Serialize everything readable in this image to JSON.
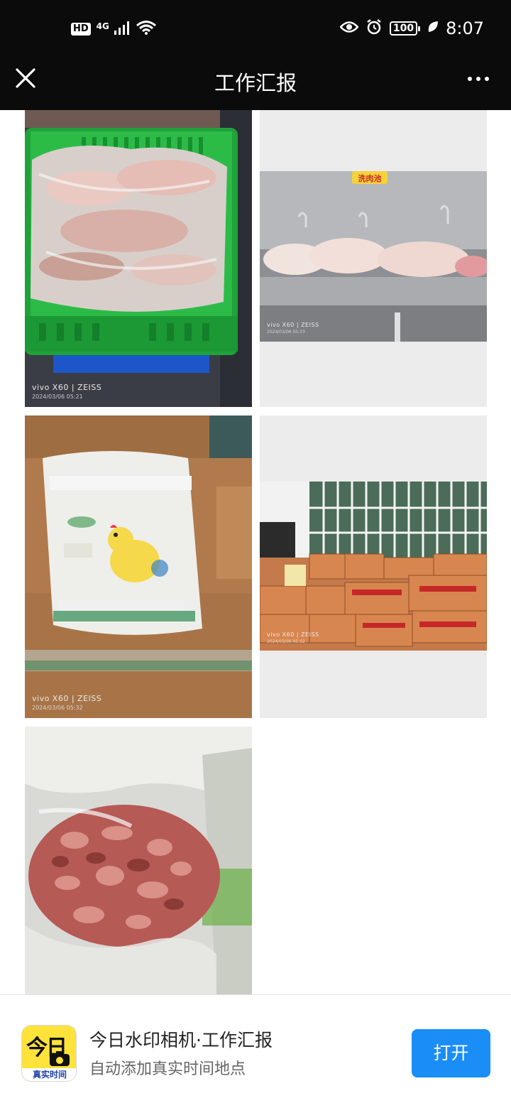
{
  "status_bar": {
    "hd": "HD",
    "network": "4G",
    "battery": "100",
    "time": "8:07"
  },
  "header": {
    "title": "工作汇报"
  },
  "photos": [
    {
      "brand": "vivo X60 | ZEISS",
      "date": "2024/03/06 05:21"
    },
    {
      "brand": "vivo X60 | ZEISS",
      "date": "2024/03/06 05:33",
      "sign": "洗肉池"
    },
    {
      "brand": "vivo X60 | ZEISS",
      "date": "2024/03/06 05:32"
    },
    {
      "brand": "vivo X60 | ZEISS",
      "date": "2024/03/06 05:32"
    },
    {
      "brand": "",
      "date": ""
    }
  ],
  "banner": {
    "icon_text": "今日",
    "icon_strip": "真实时间",
    "title": "今日水印相机·工作汇报",
    "subtitle": "自动添加真实时间地点",
    "open_label": "打开"
  },
  "colors": {
    "topbar": "#0b0b0b",
    "open_button": "#1a8df7",
    "app_icon": "#ffe23a"
  }
}
